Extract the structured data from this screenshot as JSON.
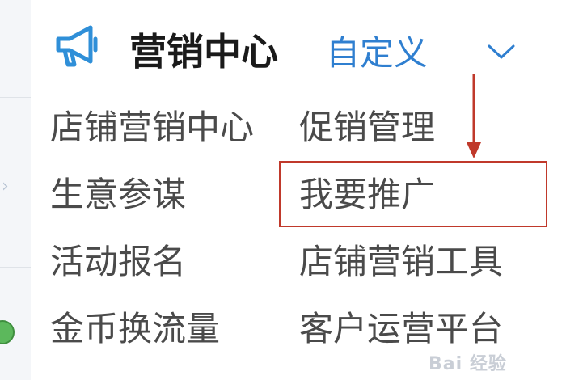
{
  "header": {
    "title": "营销中心",
    "customize_label": "自定义",
    "icon": "megaphone-icon",
    "collapse_icon": "chevron-down-icon",
    "accent_color": "#2f7fd0"
  },
  "menu": {
    "left": [
      "店铺营销中心",
      "生意参谋",
      "活动报名",
      "金币换流量"
    ],
    "right": [
      "促销管理",
      "我要推广",
      "店铺营销工具",
      "客户运营平台"
    ]
  },
  "annotation": {
    "highlighted_item": "我要推广",
    "box_color": "#c0392b"
  },
  "watermark": "Bai 经验"
}
